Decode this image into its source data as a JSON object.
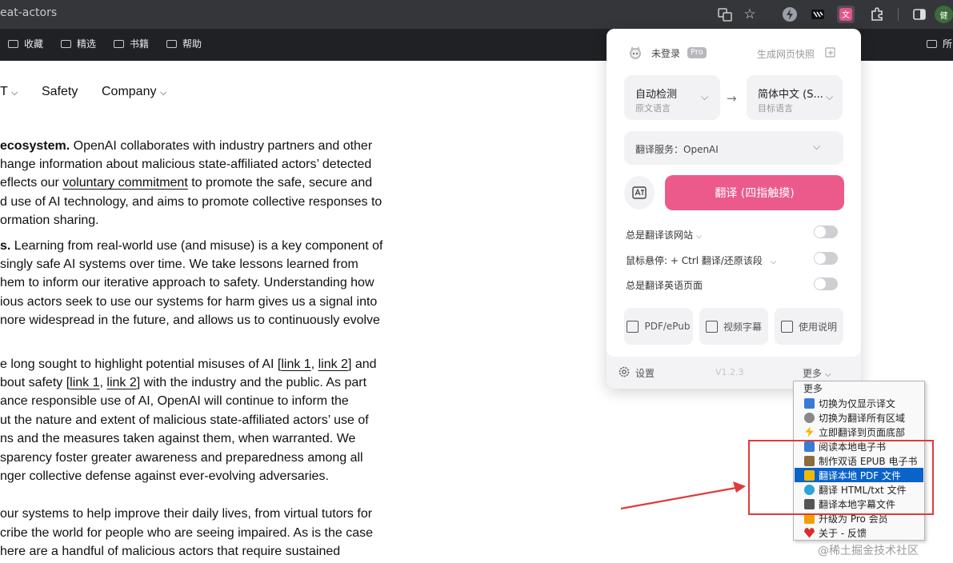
{
  "browser": {
    "url_fragment": "eat-actors",
    "bookmarks": [
      "收藏",
      "精选",
      "书籍",
      "帮助"
    ],
    "bookmark_right": "所"
  },
  "site_nav": {
    "items": [
      "T",
      "Safety",
      "Company"
    ]
  },
  "article": {
    "p1": [
      {
        "bold": "ecosystem.",
        "rest": " OpenAI collaborates with industry partners and other"
      },
      {
        "text": "hange information about malicious state-affiliated actors’ detected"
      },
      {
        "pre": "eflects our ",
        "link": "voluntary commitment",
        "post": " to promote the safe, secure and"
      },
      {
        "text": "d use of AI technology, and aims to promote collective responses to"
      },
      {
        "text": "ormation sharing."
      }
    ],
    "p2": [
      {
        "bold": "s.",
        "rest": " Learning from real-world use (and misuse) is a key component of"
      },
      {
        "text": "singly safe AI systems over time. We take lessons learned from"
      },
      {
        "text": "hem to inform our iterative approach to safety. Understanding how"
      },
      {
        "text": "ious actors seek to use our systems for harm gives us a signal into"
      },
      {
        "text": "nore widespread in the future, and allows us to continuously evolve"
      }
    ],
    "p3": [
      {
        "text": "e long sought to highlight potential misuses of AI [",
        "link1": "link 1",
        "mid": ", ",
        "link2": "link 2",
        "post": "] and"
      },
      {
        "text": "bout safety [",
        "link1": "link 1",
        "mid": ", ",
        "link2": "link 2",
        "post": "] with the industry and the public. As part"
      },
      {
        "text": "ance responsible use of AI, OpenAI will continue to inform the"
      },
      {
        "text": "ut the nature and extent of malicious state-affiliated actors’ use of"
      },
      {
        "text": "ns and the measures taken against them, when warranted. We"
      },
      {
        "text": "sparency foster greater awareness and preparedness among all"
      },
      {
        "text": "nger collective defense against ever-evolving adversaries."
      }
    ],
    "p4": [
      {
        "text": "our systems to help improve their daily lives, from virtual tutors for"
      },
      {
        "text": "cribe the world for people who are seeing impaired. As is the case"
      },
      {
        "text": "here are a handful of malicious actors that require sustained"
      }
    ]
  },
  "popup": {
    "user": "未登录",
    "pro_badge": "Pro",
    "snapshot": "生成网页快照",
    "source_lang": "自动检测",
    "source_sub": "原文语言",
    "target_lang": "简体中文 (S...",
    "target_sub": "目标语言",
    "arrow": "→",
    "service": "翻译服务：OpenAI",
    "translate_button": "翻译 (四指触摸)",
    "toggles": [
      {
        "label": "总是翻译该网站",
        "on": false
      },
      {
        "label": "鼠标悬停:  + Ctrl 翻译/还原该段",
        "on": false
      },
      {
        "label": "总是翻译英语页面",
        "on": false
      }
    ],
    "tools": [
      "PDF/ePub",
      "视频字幕",
      "使用说明"
    ],
    "settings": "设置",
    "version": "V1.2.3",
    "more": "更多"
  },
  "menu": {
    "header": "更多",
    "items": [
      {
        "label": "切换为仅显示译文",
        "icon": "display-icon",
        "color": "#3a7bd5"
      },
      {
        "label": "切换为翻译所有区域",
        "icon": "skull-icon",
        "color": "#666666"
      },
      {
        "label": "立即翻译到页面底部",
        "icon": "lightning-icon",
        "color": "#f2b800"
      },
      {
        "label": "阅读本地电子书",
        "icon": "book-icon",
        "color": "#3a7bd5"
      },
      {
        "label": "制作双语 EPUB 电子书",
        "icon": "books-icon",
        "color": "#8a6d3b"
      },
      {
        "label": "翻译本地 PDF 文件",
        "icon": "folder-icon",
        "color": "#f2b800"
      },
      {
        "label": "翻译 HTML/txt 文件",
        "icon": "globe-icon",
        "color": "#2ba4d8"
      },
      {
        "label": "翻译本地字幕文件",
        "icon": "tv-icon",
        "color": "#555555"
      },
      {
        "label": "升级为 Pro 会员",
        "icon": "gift-icon",
        "color": "#f2a000"
      },
      {
        "label": "关于 - 反馈",
        "icon": "heart-icon",
        "color": "#d82b2b"
      }
    ],
    "selected_index": 5
  },
  "watermark": "@稀土掘金技术社区",
  "colors": {
    "accent_pink": "#ec5a8c",
    "highlight": "#0a63c9",
    "annotation_red": "#e03a3a"
  }
}
